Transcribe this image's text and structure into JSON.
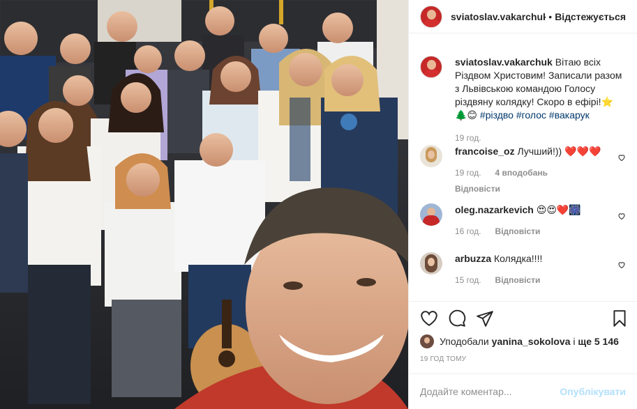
{
  "header": {
    "username": "sviatoslav.vakarchuk",
    "separator": "•",
    "follow_label": "Відстежується"
  },
  "caption": {
    "username": "sviatoslav.vakarchuk",
    "text": "Вітаю всіх Різдвом Христовим! Записали разом з Львівською командою Голосу різдвяну колядку! Скоро в ефірі!",
    "emoji": "⭐🌲😊",
    "hashtags": [
      "#різдво",
      "#голос",
      "#вакарук"
    ],
    "time": "19 год."
  },
  "comments": [
    {
      "username": "francoise_oz",
      "text": "Лучший!))",
      "emoji": "❤️❤️❤️",
      "time": "19 год.",
      "likes": "4 вподобань",
      "reply": "Відповісти"
    },
    {
      "username": "oleg.nazarkevich",
      "text": "",
      "emoji": "😍😍❤️🎆",
      "time": "16 год.",
      "likes": "",
      "reply": "Відповісти"
    },
    {
      "username": "arbuzza",
      "text": "Колядка!!!!",
      "emoji": "",
      "time": "15 год.",
      "likes": "",
      "reply": "Відповісти"
    }
  ],
  "likes": {
    "prefix": "Уподобали",
    "user": "yanina_sokolova",
    "middle": "і",
    "count_text": "ще 5 146"
  },
  "time_ago": "19 год тому",
  "add_comment": {
    "placeholder": "Додайте коментар...",
    "publish_label": "Опублікувати"
  },
  "icons": {
    "like": "heart-outline-icon",
    "comment": "comment-bubble-icon",
    "share": "paper-plane-icon",
    "save": "bookmark-icon"
  },
  "colors": {
    "link": "#00376b",
    "muted": "#8e8e8e",
    "publish_disabled": "#b2dffc"
  }
}
